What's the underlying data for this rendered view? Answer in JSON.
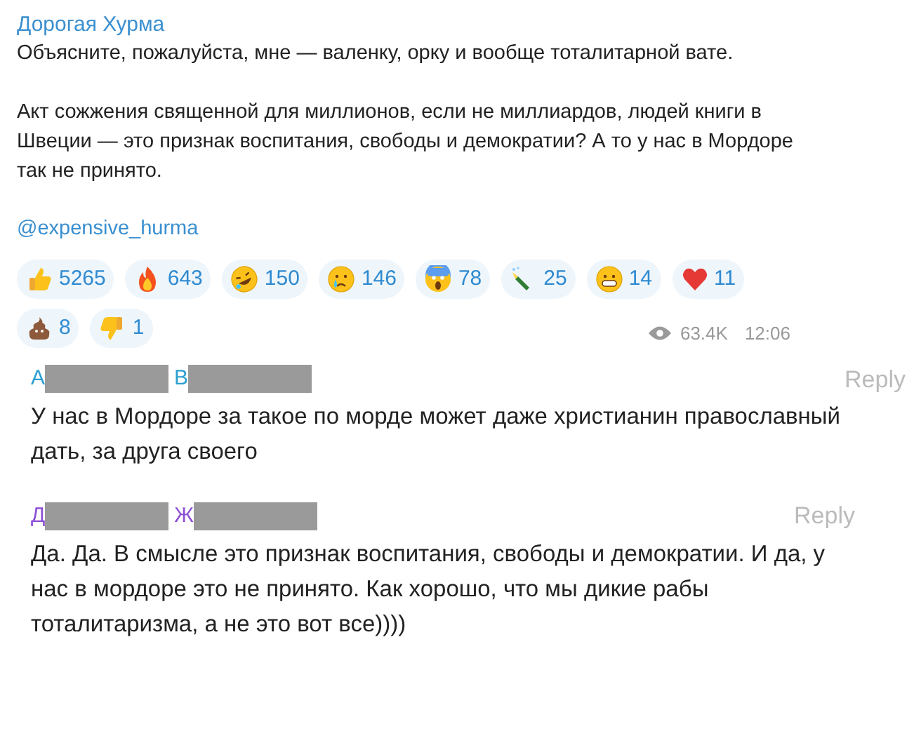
{
  "post": {
    "author": "Дорогая Хурма",
    "lines": [
      "Объясните, пожалуйста, мне — валенку, орку и вообще тоталитарной вате.",
      "Акт сожжения священной для миллионов, если не миллиардов, людей книги в Швеции — это признак воспитания, свободы и демократии? А то у нас в Мордоре так не принято."
    ],
    "signature": "@expensive_hurma",
    "reactions": [
      {
        "kind": "thumbs-up",
        "count": "5265"
      },
      {
        "kind": "fire",
        "count": "643"
      },
      {
        "kind": "rofl",
        "count": "150"
      },
      {
        "kind": "crying",
        "count": "146"
      },
      {
        "kind": "screaming",
        "count": "78"
      },
      {
        "kind": "champagne",
        "count": "25"
      },
      {
        "kind": "grin",
        "count": "14"
      },
      {
        "kind": "heart",
        "count": "11"
      },
      {
        "kind": "poop",
        "count": "8"
      },
      {
        "kind": "thumbs-down",
        "count": "1"
      }
    ],
    "views": "63.4K",
    "time": "12:06"
  },
  "comments": [
    {
      "initials": [
        "А",
        "В"
      ],
      "color": "#2b9fd1",
      "reply": "Reply",
      "text": "У нас в Мордоре за такое по морде может даже христианин православный дать, за друга своего"
    },
    {
      "initials": [
        "Д",
        "Ж"
      ],
      "color": "#8e4fd6",
      "reply": "Reply",
      "text": "Да. Да. В смысле это признак воспитания, свободы и демократии. И да, у нас в мордоре это не принято. Как хорошо, что мы дикие рабы тоталитаризма, а не это вот все))))"
    }
  ]
}
